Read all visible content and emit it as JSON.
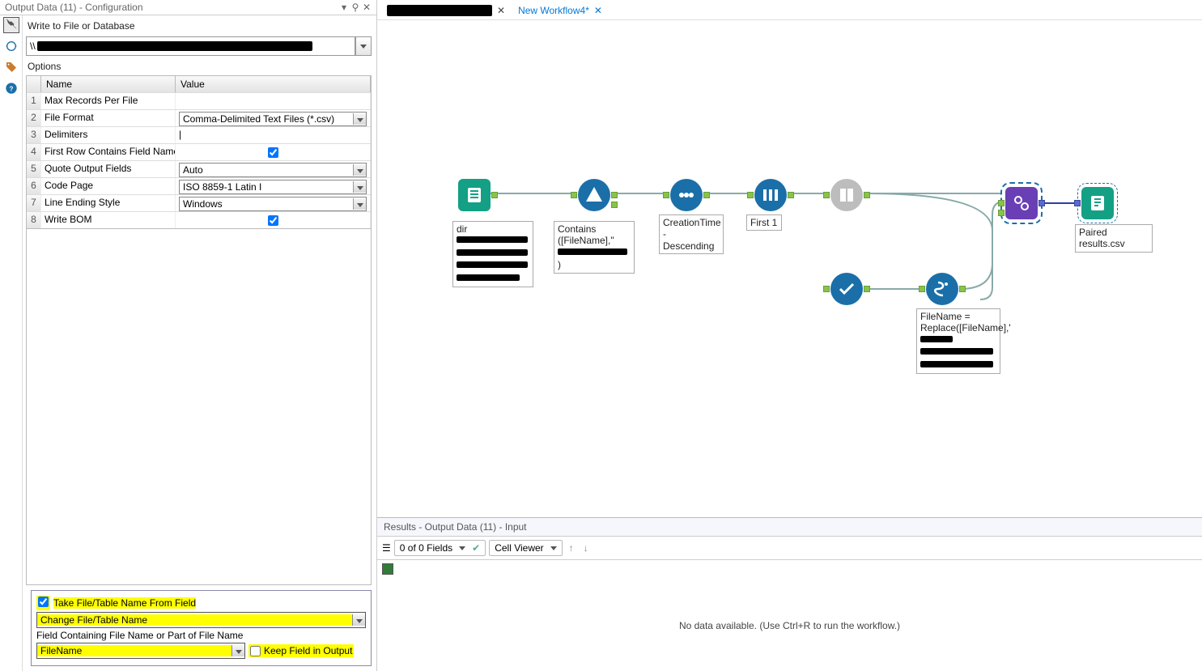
{
  "panel": {
    "title": "Output Data (11) - Configuration",
    "write_label": "Write to File or Database",
    "options_label": "Options",
    "headers": {
      "name": "Name",
      "value": "Value"
    },
    "rows": [
      {
        "n": "1",
        "name": "Max Records Per File",
        "value": ""
      },
      {
        "n": "2",
        "name": "File Format",
        "value": "Comma-Delimited Text Files (*.csv)",
        "type": "select"
      },
      {
        "n": "3",
        "name": "Delimiters",
        "value": "|"
      },
      {
        "n": "4",
        "name": "First Row Contains Field Names",
        "value": "",
        "type": "check",
        "checked": true
      },
      {
        "n": "5",
        "name": "Quote Output Fields",
        "value": "Auto",
        "type": "select"
      },
      {
        "n": "6",
        "name": "Code Page",
        "value": "ISO 8859-1 Latin I",
        "type": "select"
      },
      {
        "n": "7",
        "name": "Line Ending Style",
        "value": "Windows",
        "type": "select"
      },
      {
        "n": "8",
        "name": "Write BOM",
        "value": "",
        "type": "check",
        "checked": true
      }
    ],
    "take_label": "Take File/Table Name From Field",
    "change_mode": "Change File/Table Name",
    "field_label": "Field Containing File Name or Part of File Name",
    "field_value": "FileName",
    "keep_label": "Keep Field in Output"
  },
  "tabs": {
    "active": "New Workflow4*"
  },
  "canvas": {
    "directory_label": "dir",
    "filter_label": "Contains\n([FileName],\"",
    "sort_label": "CreationTime - Descending",
    "sample_label": "First 1",
    "formula_label": "FileName = Replace([FileName],'",
    "output_label": "Paired results.csv"
  },
  "results": {
    "title": "Results - Output Data (11) - Input",
    "fields": "0 of 0 Fields",
    "viewer": "Cell Viewer",
    "empty": "No data available. (Use Ctrl+R to run the workflow.)"
  }
}
